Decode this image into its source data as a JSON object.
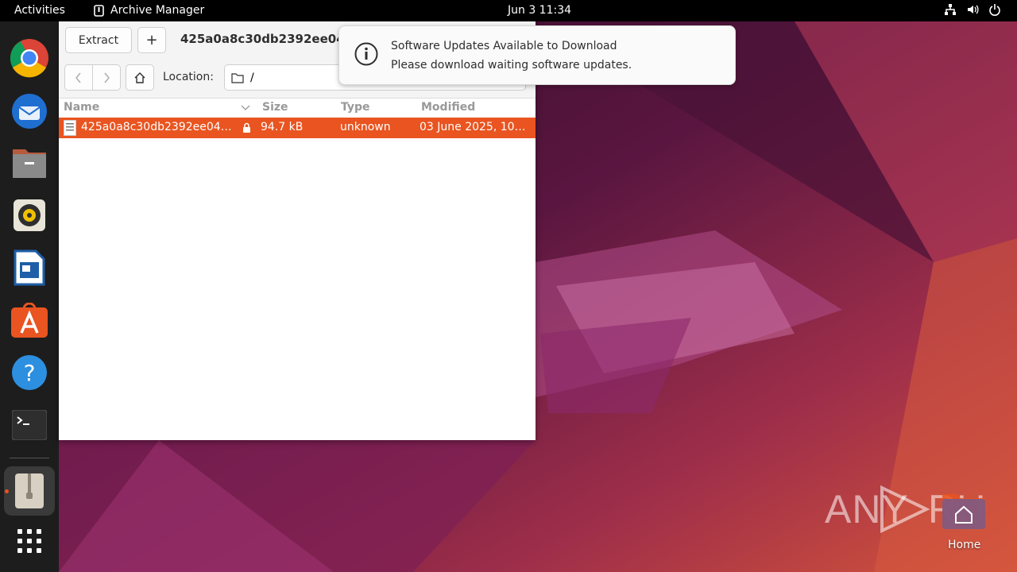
{
  "topbar": {
    "activities": "Activities",
    "app_name": "Archive Manager",
    "clock": "Jun 3  11:34"
  },
  "dock": {
    "items": [
      "chrome-icon",
      "thunderbird-icon",
      "files-icon",
      "rhythmbox-icon",
      "writer-icon",
      "app-center-icon",
      "help-icon",
      "terminal-icon",
      "archive-manager-icon",
      "show-apps-icon"
    ]
  },
  "window": {
    "extract_label": "Extract",
    "add_label": "+",
    "title": "425a0a8c30db2392ee04",
    "location_label": "Location:",
    "location_value": "/",
    "columns": {
      "name": "Name",
      "size": "Size",
      "type": "Type",
      "modified": "Modified"
    },
    "rows": [
      {
        "name": "425a0a8c30db2392ee04…",
        "size": "94.7 kB",
        "type": "unknown",
        "modified": "03 June 2025, 10…"
      }
    ]
  },
  "notification": {
    "title": "Software Updates Available to Download",
    "body": "Please download waiting software updates."
  },
  "desktop": {
    "home_label": "Home",
    "watermark": "ANY RUN"
  },
  "colors": {
    "accent": "#e95420",
    "topbar": "#000000",
    "dock": "#1d1d1d"
  }
}
